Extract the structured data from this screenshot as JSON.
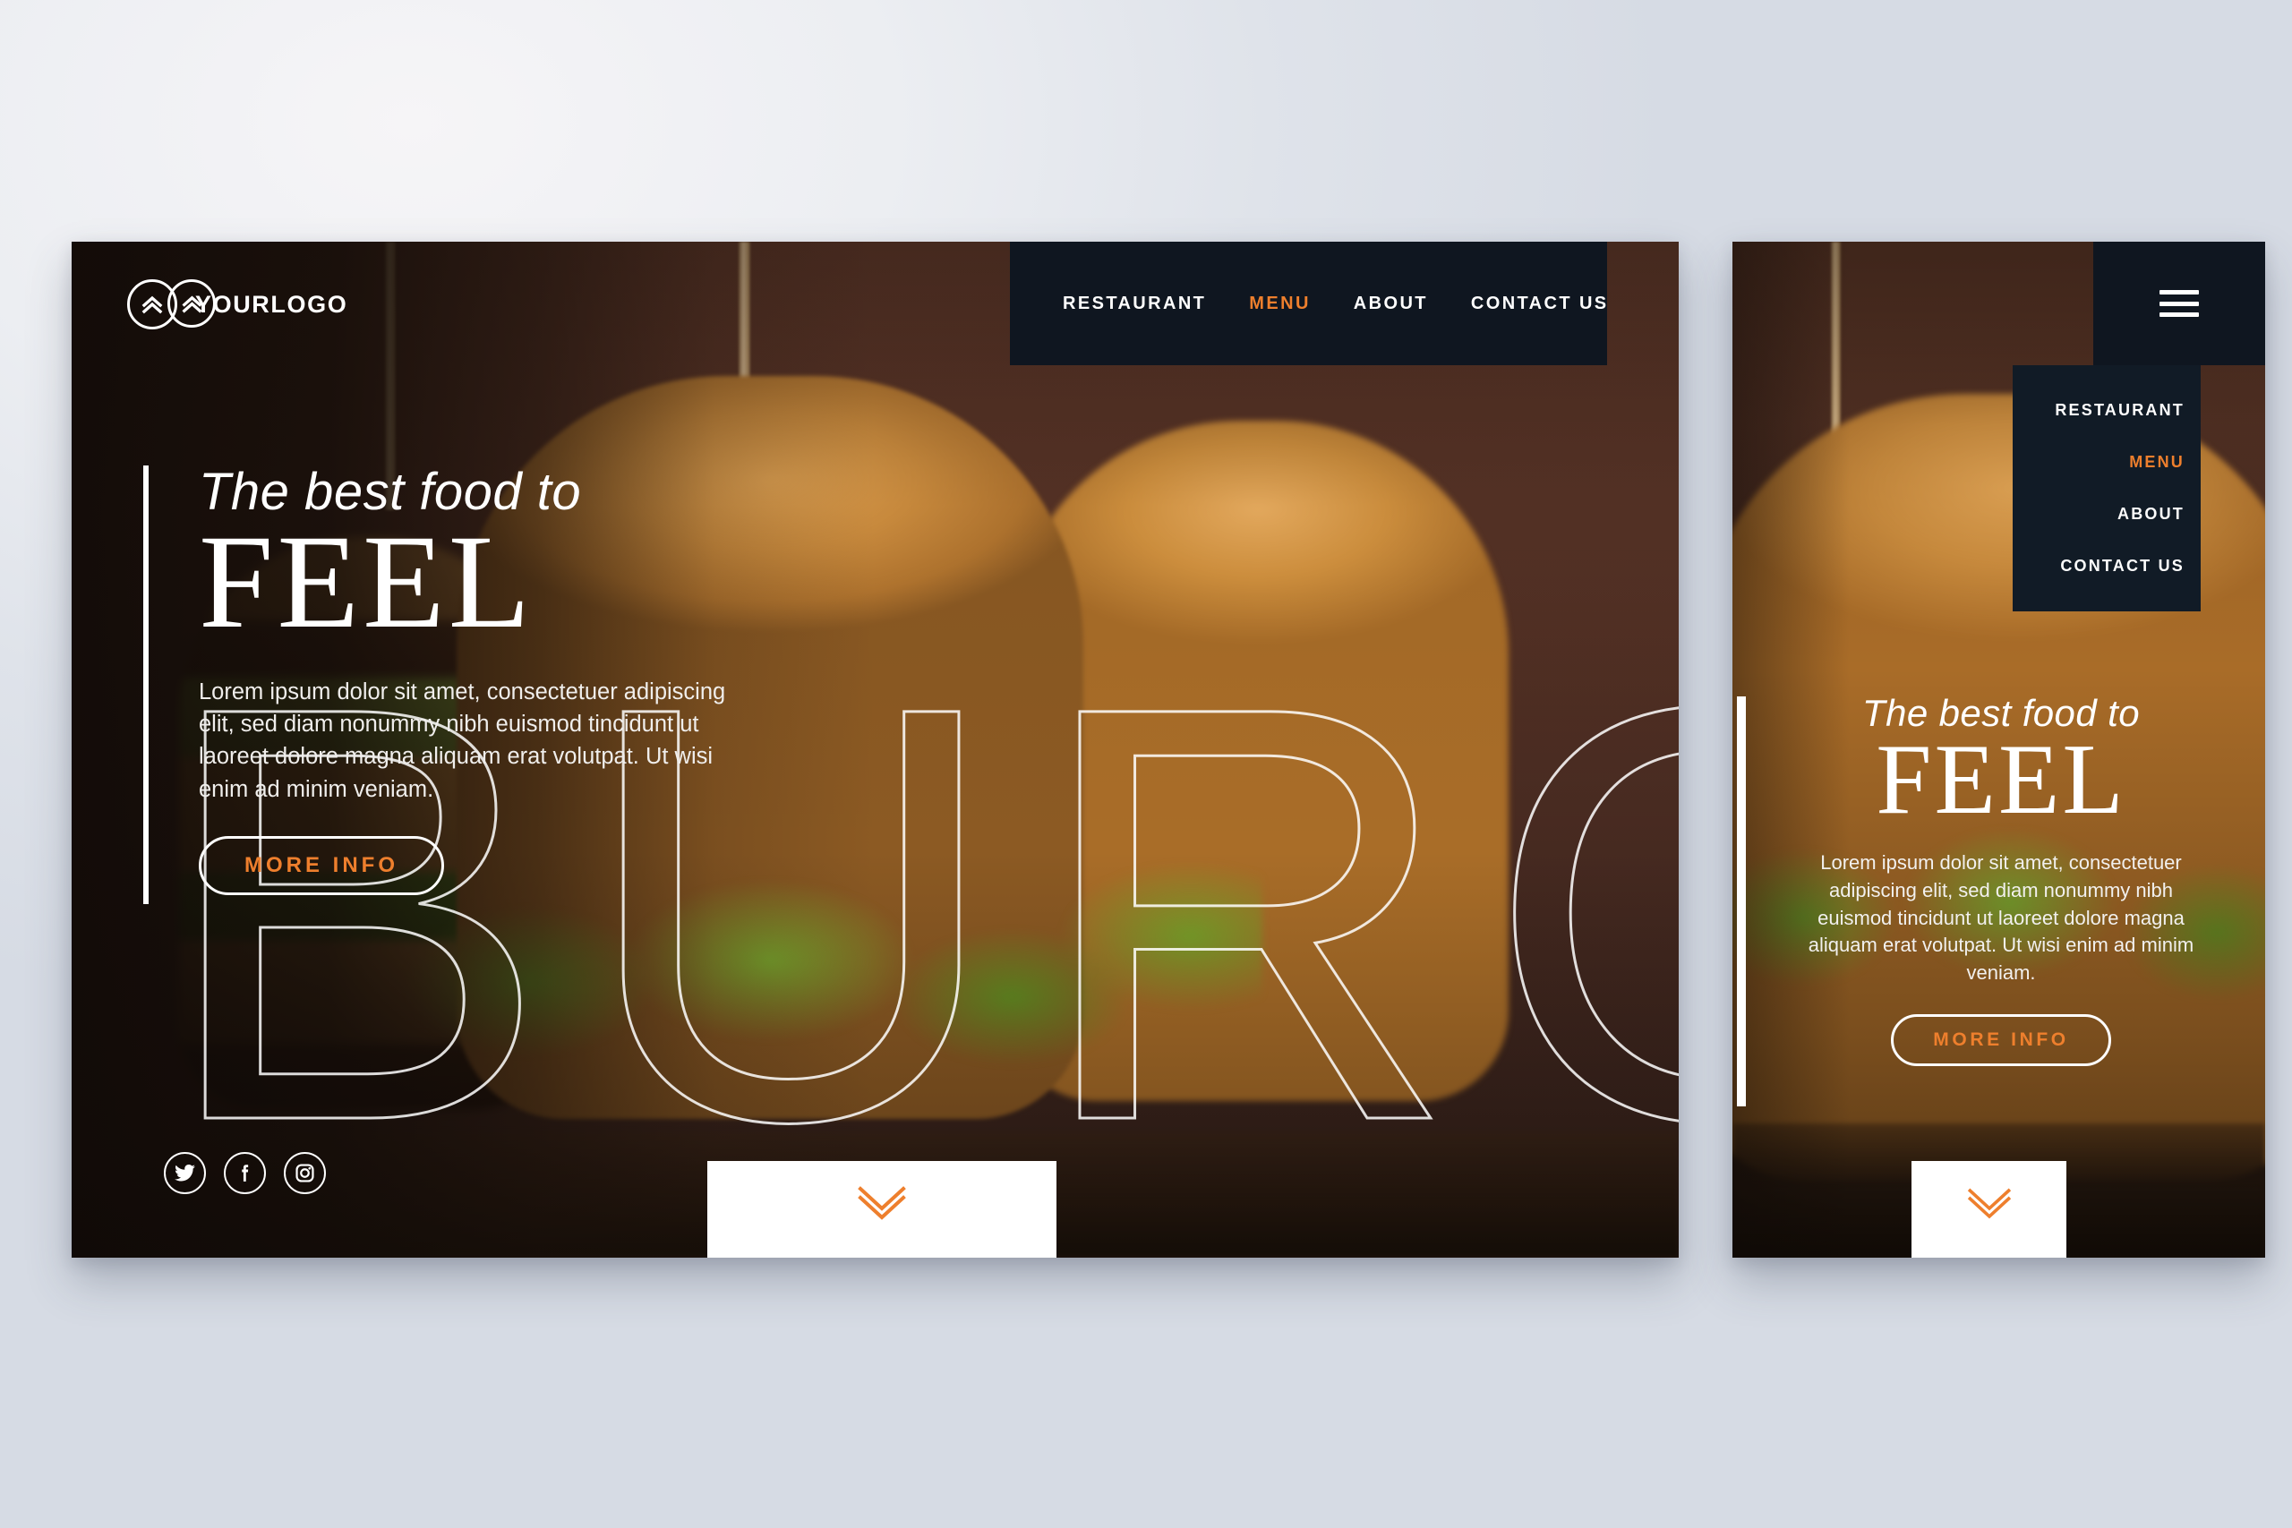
{
  "brand": {
    "logo_text": "YOURLOGO",
    "logo_icon": "double-chevron-up-circle-icon",
    "accent_color": "#ee7f2d",
    "nav_bg_color": "#0f1620"
  },
  "desktop": {
    "nav": {
      "items": [
        {
          "label": "RESTAURANT",
          "active": false
        },
        {
          "label": "MENU",
          "active": true
        },
        {
          "label": "ABOUT",
          "active": false
        },
        {
          "label": "CONTACT US",
          "active": false
        }
      ]
    },
    "hero": {
      "kicker": "The best food to",
      "title": "FEEL",
      "body": "Lorem ipsum dolor sit amet, consectetuer adipiscing elit, sed diam nonummy nibh euismod tincidunt ut laoreet dolore magna aliquam erat volutpat. Ut wisi enim ad minim veniam.",
      "cta_label": "MORE INFO",
      "watermark": "BURG"
    },
    "social": [
      {
        "name": "twitter-icon",
        "label": "Twitter"
      },
      {
        "name": "facebook-icon",
        "label": "Facebook"
      },
      {
        "name": "instagram-icon",
        "label": "Instagram"
      }
    ],
    "scroll": {
      "icon": "double-chevron-down-icon"
    }
  },
  "mobile": {
    "menu_icon": "hamburger-menu-icon",
    "nav": {
      "items": [
        {
          "label": "RESTAURANT",
          "active": false
        },
        {
          "label": "MENU",
          "active": true
        },
        {
          "label": "ABOUT",
          "active": false
        },
        {
          "label": "CONTACT US",
          "active": false
        }
      ]
    },
    "hero": {
      "kicker": "The best food to",
      "title": "FEEL",
      "body": "Lorem ipsum dolor sit amet, consectetuer adipiscing elit, sed diam nonummy nibh euismod tincidunt ut laoreet dolore magna aliquam erat volutpat. Ut wisi enim ad minim veniam.",
      "cta_label": "MORE INFO"
    },
    "scroll": {
      "icon": "double-chevron-down-icon"
    }
  }
}
